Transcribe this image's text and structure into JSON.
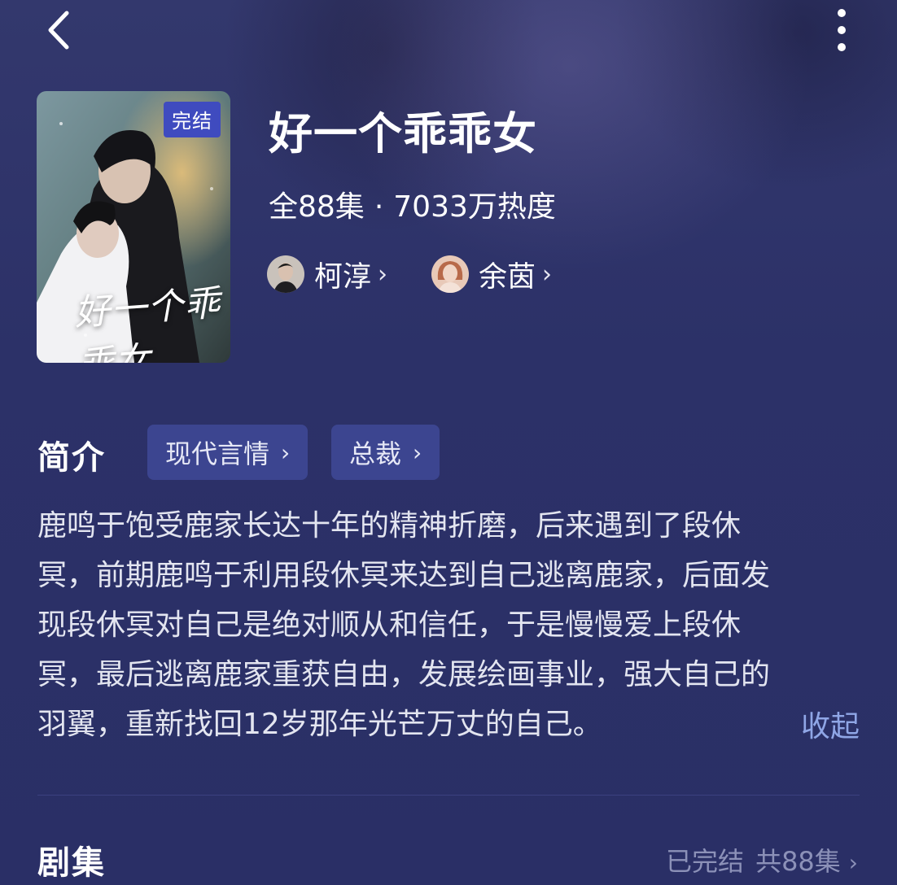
{
  "header": {
    "back_icon": "chevron-left-icon",
    "more_icon": "vertical-ellipsis-icon"
  },
  "drama": {
    "poster_badge": "完结",
    "poster_logo": "好一个乖乖女",
    "title": "好一个乖乖女",
    "episodes": "全88集",
    "separator": "·",
    "popularity": "7033万热度"
  },
  "cast": [
    {
      "name": "柯淳",
      "chevron": "›"
    },
    {
      "name": "余茵",
      "chevron": "›"
    }
  ],
  "synopsis": {
    "section_title": "简介",
    "tags": [
      {
        "label": "现代言情",
        "chevron": "›"
      },
      {
        "label": "总裁",
        "chevron": "›"
      }
    ],
    "lines": [
      "鹿鸣于饱受鹿家长达十年的精神折磨，后来遇到了段休",
      "冥，前期鹿鸣于利用段休冥来达到自己逃离鹿家，后面发",
      "现段休冥对自己是绝对顺从和信任，于是慢慢爱上段休",
      "冥，最后逃离鹿家重获自由，发展绘画事业，强大自己的",
      "羽翼，重新找回12岁那年光芒万丈的自己。"
    ],
    "collapse_label": "收起"
  },
  "episodes_section": {
    "section_title": "剧集",
    "status": "已完结",
    "count": "共88集",
    "chevron": "›"
  },
  "colors": {
    "background": "#2b3065",
    "badge": "#3f4bbf",
    "tag_bg": "#3c4590",
    "link": "#8fa6e6",
    "muted": "#8c91b8"
  }
}
